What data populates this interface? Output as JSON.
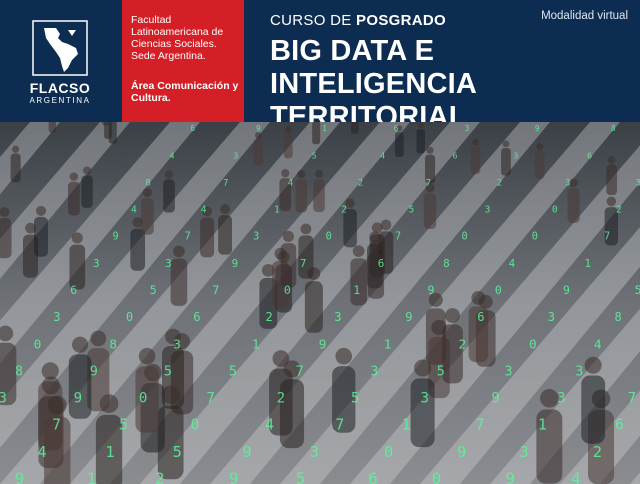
{
  "brand": {
    "name": "FLACSO",
    "sub": "ARGENTINA",
    "institution": "Facultad Latinoamericana de Ciencias Sociales. Sede Argentina.",
    "area": "Área Comunicación y Cultura."
  },
  "course": {
    "kicker_prefix": "CURSO DE ",
    "kicker_bold": "POSGRADO",
    "title": "BIG DATA E INTELIGENCIA TERRITORIAL",
    "modality": "Modalidad virtual"
  },
  "colors": {
    "navy": "#0c2c52",
    "red": "#d41f26",
    "data_glow": "#38e07a"
  },
  "photo": {
    "icon": "crowd-with-green-data-digits-image"
  }
}
